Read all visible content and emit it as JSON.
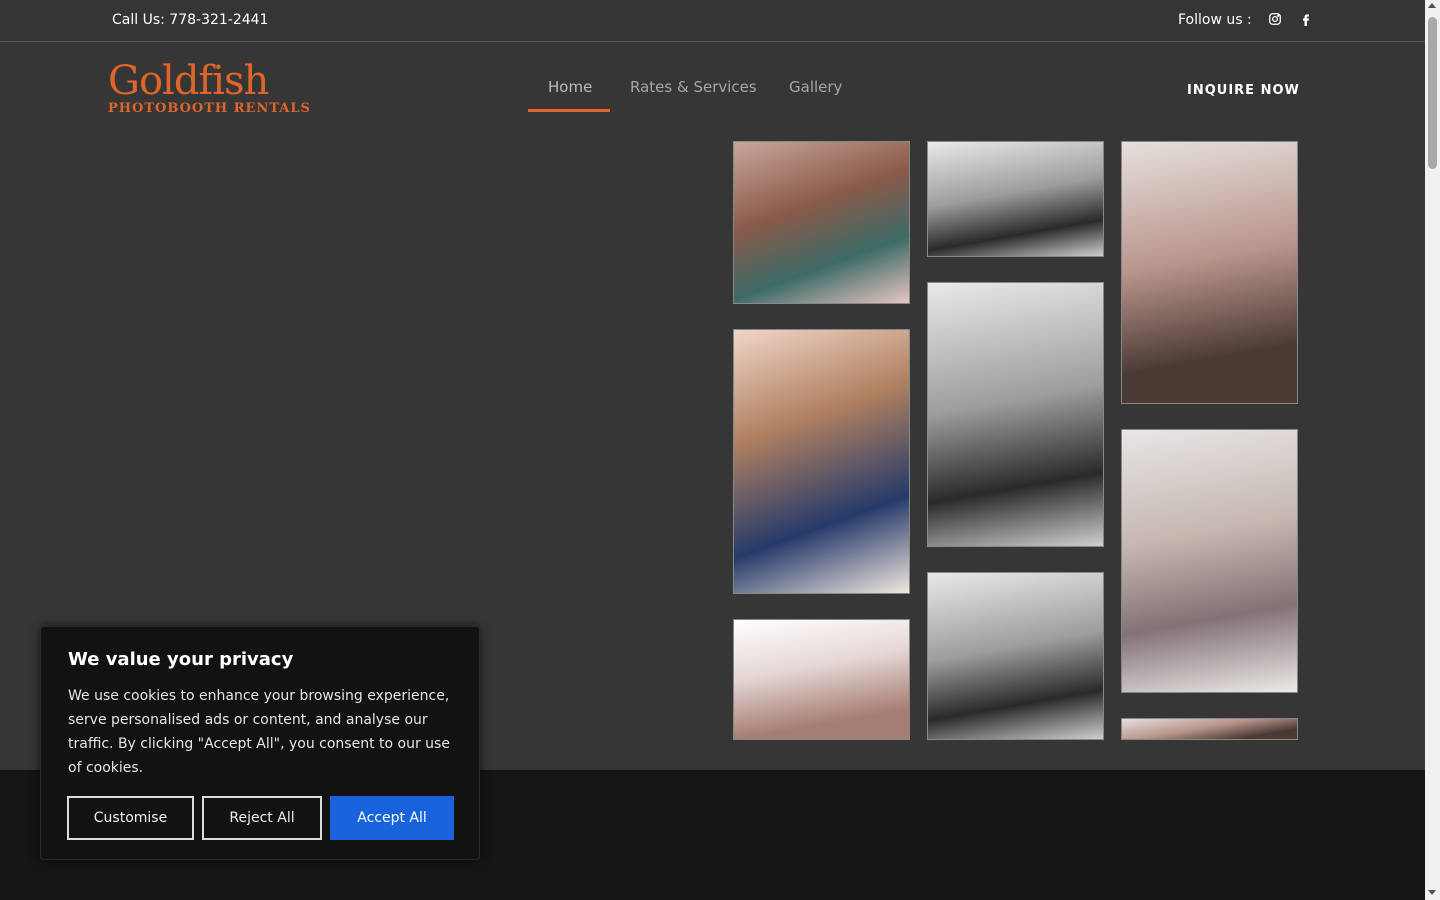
{
  "topbar": {
    "phone_text": "Call Us: 778-321-2441",
    "follow_text": "Follow us :",
    "social": [
      "instagram-icon",
      "facebook-icon"
    ]
  },
  "logo": {
    "main": "Goldfish",
    "sub": "PHOTOBOOTH RENTALS"
  },
  "nav": {
    "items": [
      {
        "label": "Home",
        "active": true
      },
      {
        "label": "Rates & Services",
        "active": false
      },
      {
        "label": "Gallery",
        "active": false
      }
    ],
    "cta": "INQUIRE NOW"
  },
  "cookie": {
    "title": "We value your privacy",
    "body": "We use cookies to enhance your browsing experience, serve personalised ads or content, and analyse our traffic. By clicking \"Accept All\", you consent to our use of cookies.",
    "customise": "Customise",
    "reject": "Reject All",
    "accept": "Accept All"
  },
  "colors": {
    "brand": "#e0652a",
    "background": "#363636",
    "footer": "#151515",
    "accept_button": "#1863dc"
  }
}
